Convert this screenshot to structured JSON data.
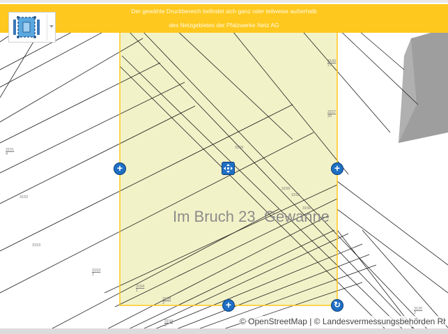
{
  "banner": {
    "line1": "Der gewähte Druckbereich befindet sich ganz oder teilweise außerhalb",
    "line2": "des Netzgebietes der Pfalzwerke Netz AG",
    "color": "#ffc81e"
  },
  "toolbar": {
    "tool_icon": "print-area-icon",
    "dropdown_icon": "caret-down-icon"
  },
  "map": {
    "area_label": "Im Bruch 23. Gewanne",
    "attribution": "© OpenStreetMap | © Landesvermessungsbehörden Rh...",
    "print_area_fill": "#f2f2c8",
    "print_area_border": "#ffc81e",
    "handle_color": "#1f6fc4"
  },
  "parcels": [
    {
      "num": "3151",
      "sub": "4"
    },
    {
      "num": "3152",
      "sub": ""
    },
    {
      "num": "3153",
      "sub": ""
    },
    {
      "num": "3153",
      "sub": "2"
    },
    {
      "num": "3154",
      "sub": "1"
    },
    {
      "num": "3154",
      "sub": "2"
    },
    {
      "num": "3154",
      "sub": "3"
    },
    {
      "num": "3159",
      "sub": ""
    },
    {
      "num": "3160",
      "sub": "27"
    },
    {
      "num": "3157",
      "sub": "20"
    },
    {
      "num": "3159",
      "sub": ""
    },
    {
      "num": "3158",
      "sub": ""
    },
    {
      "num": "3156",
      "sub": ""
    },
    {
      "num": "3120",
      "sub": "2"
    }
  ]
}
